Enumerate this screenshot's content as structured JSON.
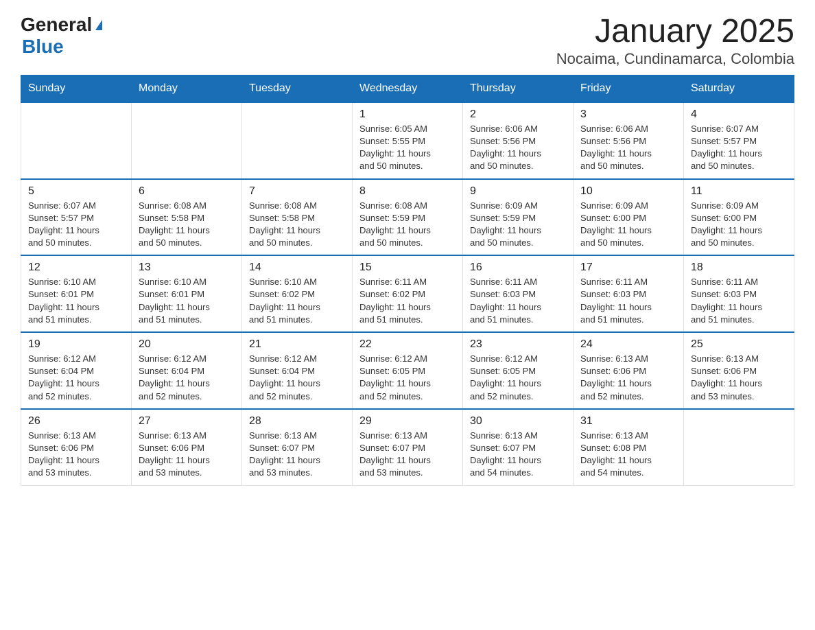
{
  "header": {
    "logo_general": "General",
    "logo_blue": "Blue",
    "title": "January 2025",
    "subtitle": "Nocaima, Cundinamarca, Colombia"
  },
  "days_of_week": [
    "Sunday",
    "Monday",
    "Tuesday",
    "Wednesday",
    "Thursday",
    "Friday",
    "Saturday"
  ],
  "weeks": [
    [
      {
        "day": "",
        "info": ""
      },
      {
        "day": "",
        "info": ""
      },
      {
        "day": "",
        "info": ""
      },
      {
        "day": "1",
        "info": "Sunrise: 6:05 AM\nSunset: 5:55 PM\nDaylight: 11 hours\nand 50 minutes."
      },
      {
        "day": "2",
        "info": "Sunrise: 6:06 AM\nSunset: 5:56 PM\nDaylight: 11 hours\nand 50 minutes."
      },
      {
        "day": "3",
        "info": "Sunrise: 6:06 AM\nSunset: 5:56 PM\nDaylight: 11 hours\nand 50 minutes."
      },
      {
        "day": "4",
        "info": "Sunrise: 6:07 AM\nSunset: 5:57 PM\nDaylight: 11 hours\nand 50 minutes."
      }
    ],
    [
      {
        "day": "5",
        "info": "Sunrise: 6:07 AM\nSunset: 5:57 PM\nDaylight: 11 hours\nand 50 minutes."
      },
      {
        "day": "6",
        "info": "Sunrise: 6:08 AM\nSunset: 5:58 PM\nDaylight: 11 hours\nand 50 minutes."
      },
      {
        "day": "7",
        "info": "Sunrise: 6:08 AM\nSunset: 5:58 PM\nDaylight: 11 hours\nand 50 minutes."
      },
      {
        "day": "8",
        "info": "Sunrise: 6:08 AM\nSunset: 5:59 PM\nDaylight: 11 hours\nand 50 minutes."
      },
      {
        "day": "9",
        "info": "Sunrise: 6:09 AM\nSunset: 5:59 PM\nDaylight: 11 hours\nand 50 minutes."
      },
      {
        "day": "10",
        "info": "Sunrise: 6:09 AM\nSunset: 6:00 PM\nDaylight: 11 hours\nand 50 minutes."
      },
      {
        "day": "11",
        "info": "Sunrise: 6:09 AM\nSunset: 6:00 PM\nDaylight: 11 hours\nand 50 minutes."
      }
    ],
    [
      {
        "day": "12",
        "info": "Sunrise: 6:10 AM\nSunset: 6:01 PM\nDaylight: 11 hours\nand 51 minutes."
      },
      {
        "day": "13",
        "info": "Sunrise: 6:10 AM\nSunset: 6:01 PM\nDaylight: 11 hours\nand 51 minutes."
      },
      {
        "day": "14",
        "info": "Sunrise: 6:10 AM\nSunset: 6:02 PM\nDaylight: 11 hours\nand 51 minutes."
      },
      {
        "day": "15",
        "info": "Sunrise: 6:11 AM\nSunset: 6:02 PM\nDaylight: 11 hours\nand 51 minutes."
      },
      {
        "day": "16",
        "info": "Sunrise: 6:11 AM\nSunset: 6:03 PM\nDaylight: 11 hours\nand 51 minutes."
      },
      {
        "day": "17",
        "info": "Sunrise: 6:11 AM\nSunset: 6:03 PM\nDaylight: 11 hours\nand 51 minutes."
      },
      {
        "day": "18",
        "info": "Sunrise: 6:11 AM\nSunset: 6:03 PM\nDaylight: 11 hours\nand 51 minutes."
      }
    ],
    [
      {
        "day": "19",
        "info": "Sunrise: 6:12 AM\nSunset: 6:04 PM\nDaylight: 11 hours\nand 52 minutes."
      },
      {
        "day": "20",
        "info": "Sunrise: 6:12 AM\nSunset: 6:04 PM\nDaylight: 11 hours\nand 52 minutes."
      },
      {
        "day": "21",
        "info": "Sunrise: 6:12 AM\nSunset: 6:04 PM\nDaylight: 11 hours\nand 52 minutes."
      },
      {
        "day": "22",
        "info": "Sunrise: 6:12 AM\nSunset: 6:05 PM\nDaylight: 11 hours\nand 52 minutes."
      },
      {
        "day": "23",
        "info": "Sunrise: 6:12 AM\nSunset: 6:05 PM\nDaylight: 11 hours\nand 52 minutes."
      },
      {
        "day": "24",
        "info": "Sunrise: 6:13 AM\nSunset: 6:06 PM\nDaylight: 11 hours\nand 52 minutes."
      },
      {
        "day": "25",
        "info": "Sunrise: 6:13 AM\nSunset: 6:06 PM\nDaylight: 11 hours\nand 53 minutes."
      }
    ],
    [
      {
        "day": "26",
        "info": "Sunrise: 6:13 AM\nSunset: 6:06 PM\nDaylight: 11 hours\nand 53 minutes."
      },
      {
        "day": "27",
        "info": "Sunrise: 6:13 AM\nSunset: 6:06 PM\nDaylight: 11 hours\nand 53 minutes."
      },
      {
        "day": "28",
        "info": "Sunrise: 6:13 AM\nSunset: 6:07 PM\nDaylight: 11 hours\nand 53 minutes."
      },
      {
        "day": "29",
        "info": "Sunrise: 6:13 AM\nSunset: 6:07 PM\nDaylight: 11 hours\nand 53 minutes."
      },
      {
        "day": "30",
        "info": "Sunrise: 6:13 AM\nSunset: 6:07 PM\nDaylight: 11 hours\nand 54 minutes."
      },
      {
        "day": "31",
        "info": "Sunrise: 6:13 AM\nSunset: 6:08 PM\nDaylight: 11 hours\nand 54 minutes."
      },
      {
        "day": "",
        "info": ""
      }
    ]
  ],
  "colors": {
    "header_bg": "#1a6eb5",
    "header_text": "#ffffff",
    "border_top": "#1a6eb5"
  }
}
